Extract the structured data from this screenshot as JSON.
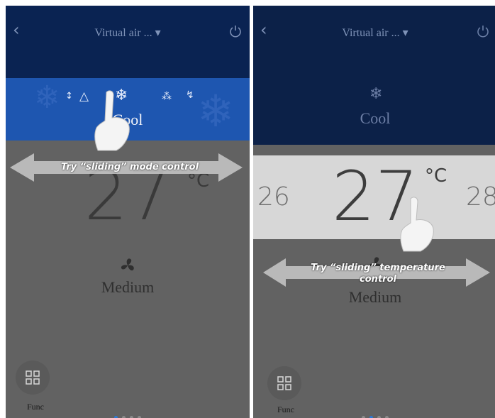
{
  "screens": [
    {
      "header": {
        "back_glyph": "‹",
        "title": "Virtual air ... ▾"
      },
      "mode": {
        "icons": [
          "↕",
          "🔔",
          "❄",
          "💧",
          "↯"
        ],
        "label": "Cool"
      },
      "temperature": {
        "value": "27",
        "unit": "°C"
      },
      "fan": {
        "icon": "fan-icon",
        "label": "Medium"
      },
      "footer": {
        "func_label": "Func"
      },
      "pagination": {
        "count": 4,
        "active": 0
      },
      "hint": {
        "text": "Try “sliding” mode control"
      }
    },
    {
      "header": {
        "back_glyph": "‹",
        "title": "Virtual air ... ▾"
      },
      "mode": {
        "label": "Cool"
      },
      "temperature": {
        "prev": "26",
        "value": "27",
        "next": "28",
        "unit": "°C"
      },
      "fan": {
        "icon": "fan-icon",
        "label": "Medium"
      },
      "footer": {
        "func_label": "Func"
      },
      "pagination": {
        "count": 4,
        "active": 1
      },
      "hint": {
        "line1": "Try “sliding” temperature",
        "line2": "control"
      }
    }
  ],
  "colors": {
    "header": "#0a2352",
    "mode_band": "#1e56b0",
    "overlay": "#626262",
    "active_dot": "#2d7ad6"
  }
}
